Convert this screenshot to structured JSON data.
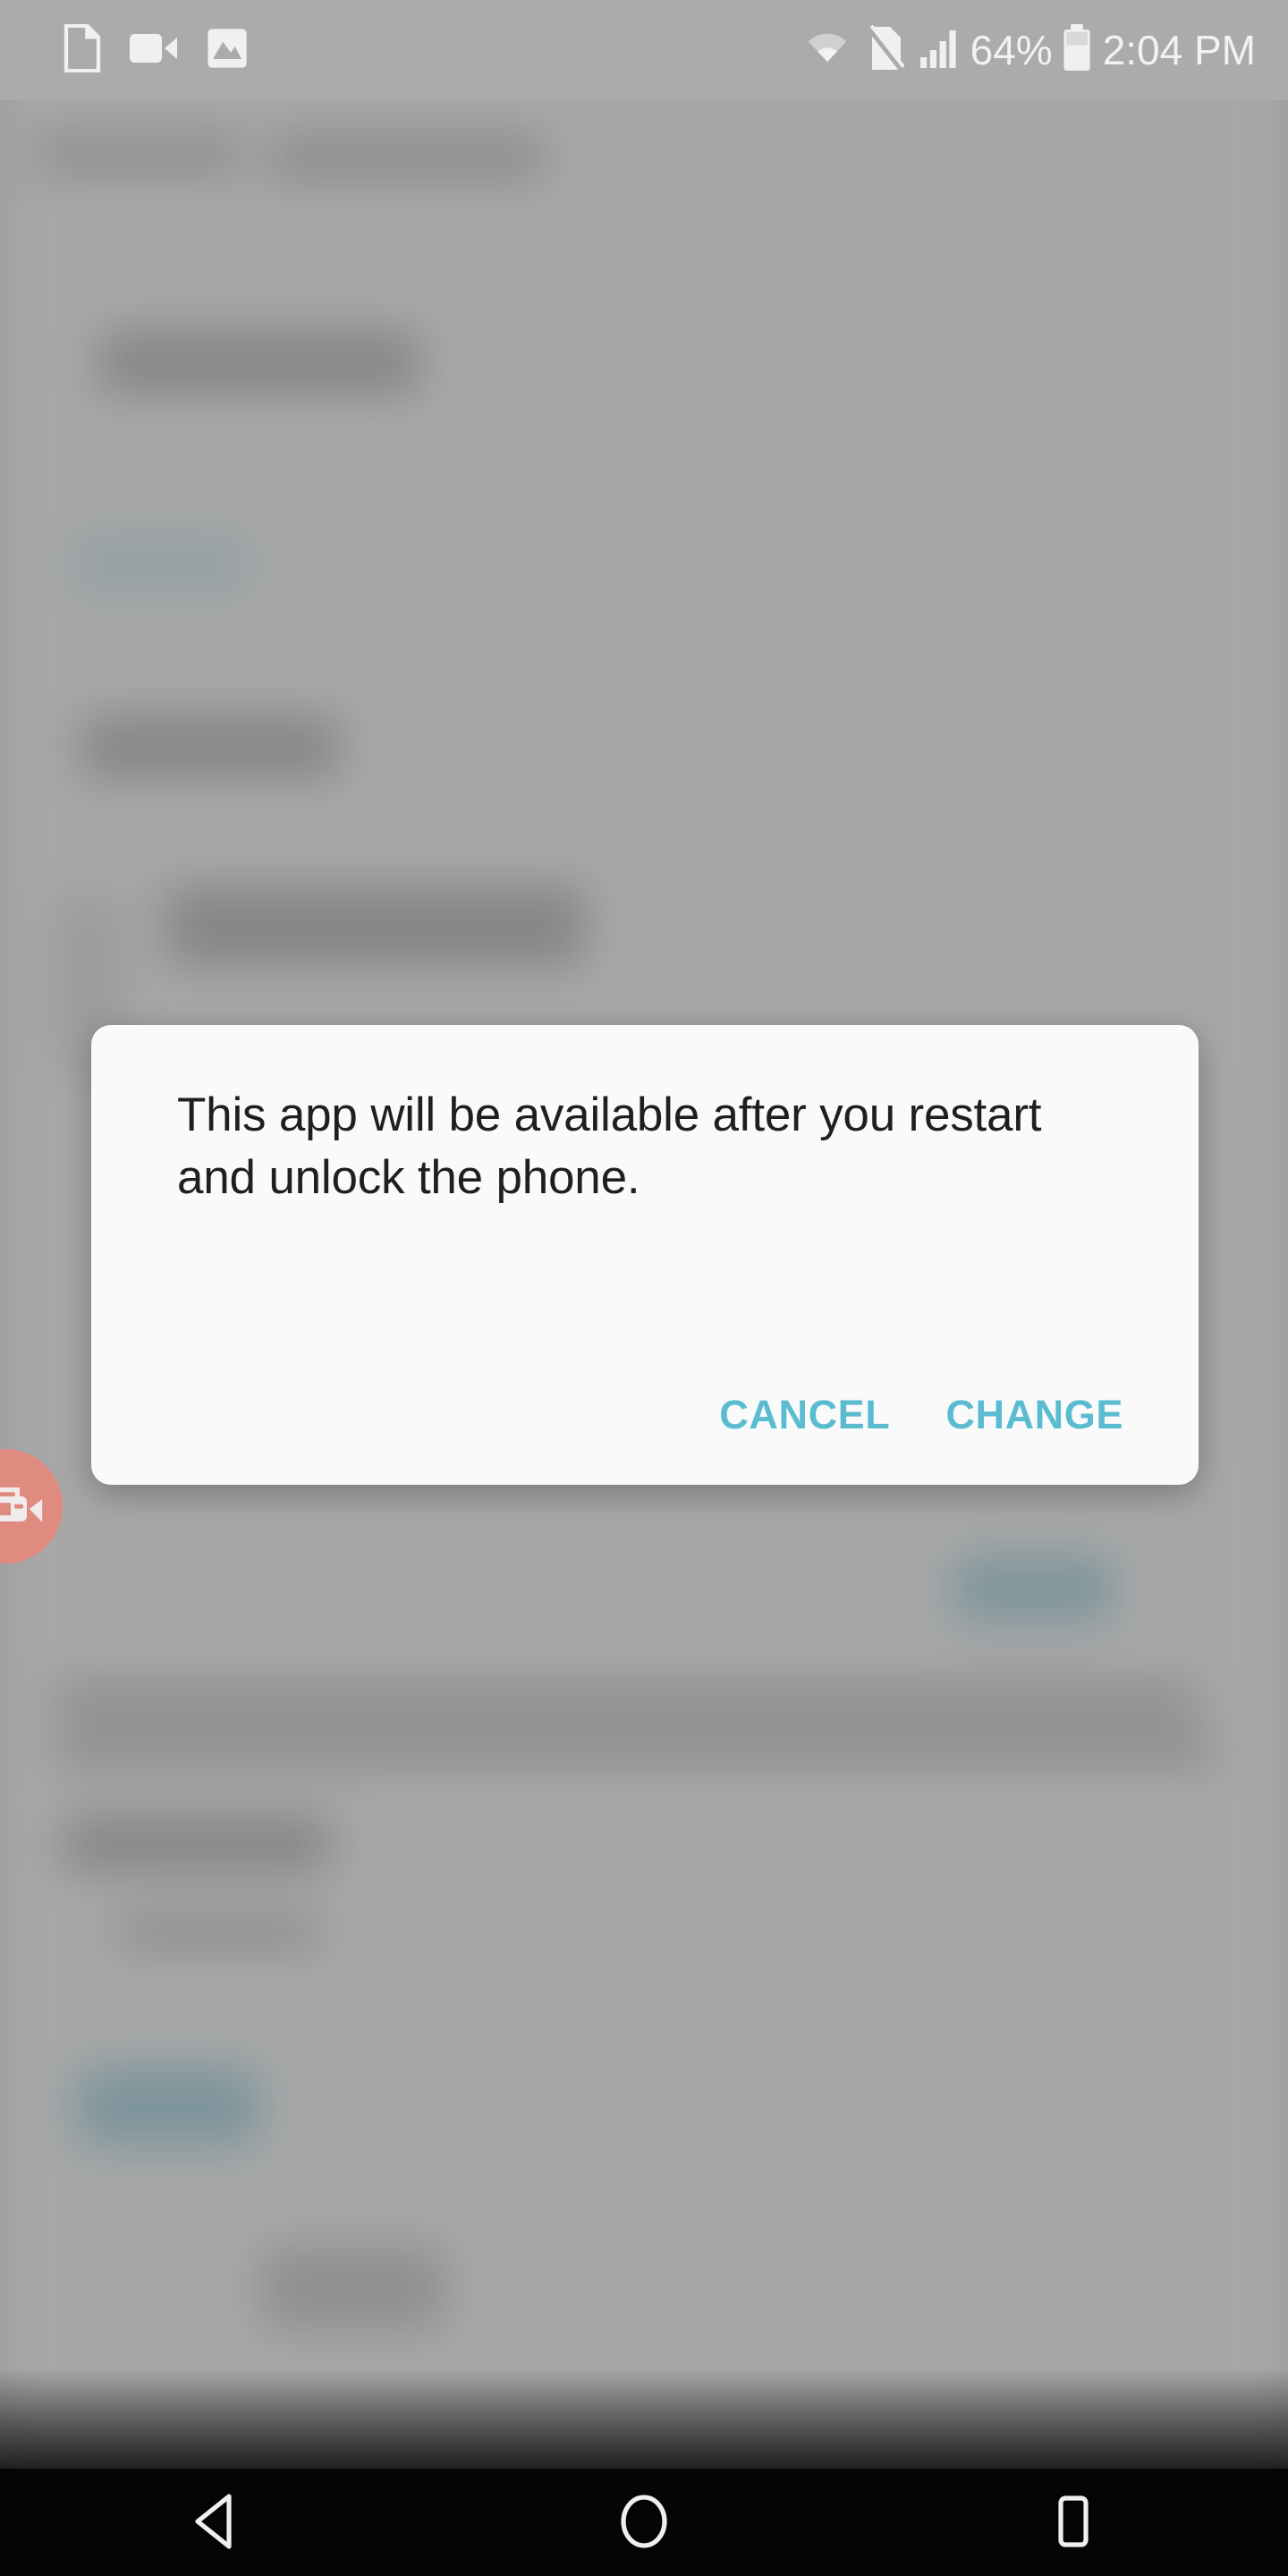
{
  "status_bar": {
    "notifications": [
      {
        "name": "document-icon",
        "label": "Document notification"
      },
      {
        "name": "video-camera-icon",
        "label": "Video recording notification"
      },
      {
        "name": "image-icon",
        "label": "Screenshot notification"
      }
    ],
    "wifi_icon": "wifi-icon",
    "sim_off_icon": "sim-card-off-icon",
    "signal_icon": "signal-bars-icon",
    "battery_percent": "64%",
    "battery_icon": "battery-icon",
    "clock": "2:04 PM",
    "background_color": "#ababab",
    "foreground_color": "#f2f2f2"
  },
  "overlay": {
    "scrim_color": "rgba(122,122,122,0.42)"
  },
  "floating_button": {
    "name": "screen-recorder-fab",
    "icon": "screen-record-camera-icon",
    "color": "#e08b7f"
  },
  "dialog": {
    "message": "This app will be available after you restart and unlock the phone.",
    "buttons": [
      {
        "name": "cancel-button",
        "label": "CANCEL"
      },
      {
        "name": "change-button",
        "label": "CHANGE"
      }
    ],
    "accent_color": "#5bbcd1",
    "surface_color": "#fafafa"
  },
  "navigation_bar": {
    "buttons": [
      {
        "name": "nav-back-button",
        "icon": "back-triangle-icon"
      },
      {
        "name": "nav-home-button",
        "icon": "home-circle-icon"
      },
      {
        "name": "nav-recents-button",
        "icon": "recents-square-icon"
      }
    ],
    "color": "#050505",
    "icon_color": "#f0f0f0"
  }
}
